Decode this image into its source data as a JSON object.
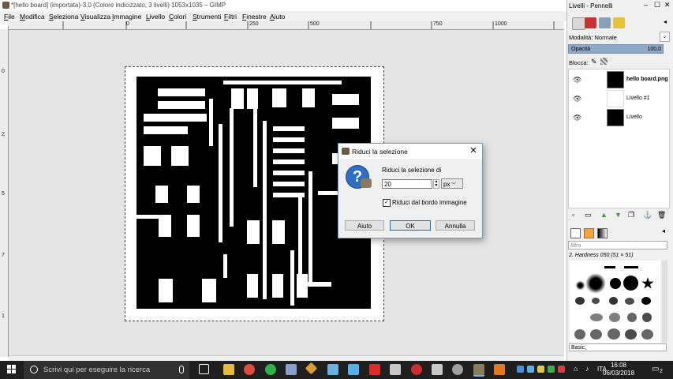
{
  "window": {
    "title": "*[hello board] (importata)-3.0 (Colore indicizzato, 3 livelli) 1053x1035 – GIMP"
  },
  "menu": [
    "File",
    "Modifica",
    "Seleziona",
    "Visualizza",
    "Immagine",
    "Livello",
    "Colori",
    "Strumenti",
    "Filtri",
    "Finestre",
    "Aiuto"
  ],
  "ruler": {
    "top": [
      "0",
      "250",
      "500",
      "750",
      "1000"
    ],
    "left": [
      "0",
      "2",
      "5",
      "7",
      "1"
    ]
  },
  "dialog": {
    "title": "Riduci la selezione",
    "prompt": "Riduci la selezione di",
    "value": "20",
    "unit": "px",
    "checkbox_label": "Riduci dal bordo immagine",
    "checked": true,
    "buttons": {
      "help": "Aiuto",
      "ok": "OK",
      "cancel": "Annulla"
    }
  },
  "dock": {
    "title": "Livelli - Pennelli",
    "mode_label": "Modalità: Normale",
    "opacity_label": "Opacità",
    "opacity_value": "100,0",
    "opacity": 1.0,
    "lock_label": "Blocca:",
    "layers": [
      {
        "name": "hello board.png",
        "bold": true
      },
      {
        "name": "Livello #1",
        "bold": false
      },
      {
        "name": "Livello",
        "bold": false
      }
    ],
    "brush_filter_placeholder": "filtro",
    "brush_name": "2. Hardness 050 (51 × 51)",
    "brush_tag": "Basic,"
  },
  "taskbar": {
    "search_placeholder": "Scrivi qui per eseguire la ricerca",
    "lang": "ITA",
    "time": "16:08",
    "date": "06/03/2018",
    "notifications": "2"
  },
  "colors": {
    "accent": "#0078d7",
    "board": "#000000",
    "canvas_bg": "#e4e4e4"
  }
}
